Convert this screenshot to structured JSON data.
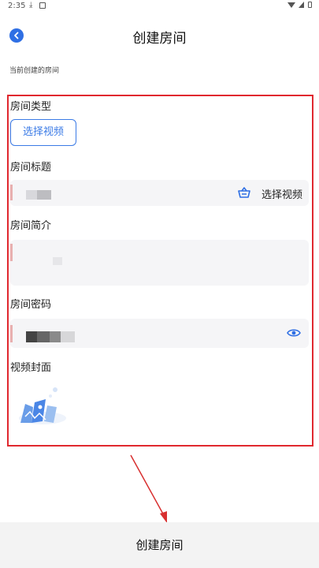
{
  "status_bar": {
    "time": "2:35",
    "download_icon": "⤓",
    "icons": [
      "download-icon",
      "media-icon",
      "wifi-icon",
      "signal-icon",
      "battery-icon"
    ]
  },
  "header": {
    "title": "创建房间",
    "back_icon": "back-arrow-icon"
  },
  "section_caption": "当前创建的房间",
  "form": {
    "room_type_label": "房间类型",
    "select_video_button": "选择视频",
    "room_title_label": "房间标题",
    "room_title_action": "选择视频",
    "room_intro_label": "房间简介",
    "room_password_label": "房间密码",
    "video_cover_label": "视频封面"
  },
  "footer": {
    "create_button": "创建房间"
  },
  "colors": {
    "accent": "#2f6fe4",
    "highlight": "#e0282f",
    "input_bg": "#f5f5f7"
  }
}
